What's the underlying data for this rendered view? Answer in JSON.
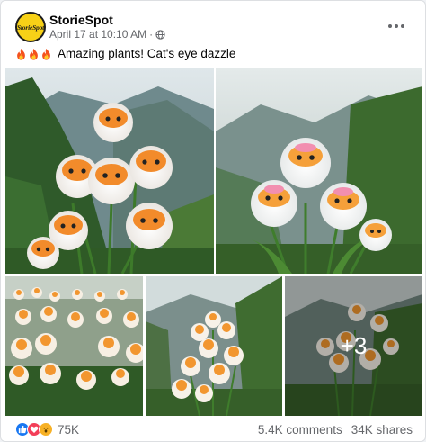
{
  "post": {
    "author": "StorieSpot",
    "avatar_text": "StorieSpot",
    "date": "April 17 at 10:10 AM",
    "separator": "·",
    "privacy_icon": "globe-icon",
    "caption_emojis": [
      "fire-icon",
      "fire-icon",
      "fire-icon"
    ],
    "caption": "Amazing plants! Cat's eye dazzle",
    "more_photos_label": "+3",
    "photos": [
      "cat-eye-flower-photo-1",
      "cat-eye-flower-photo-2",
      "cat-eye-flower-photo-3",
      "cat-eye-flower-photo-4",
      "cat-eye-flower-photo-5"
    ]
  },
  "footer": {
    "reaction_icons": [
      "like-icon",
      "love-icon",
      "wow-icon"
    ],
    "reaction_count": "75K",
    "comments": "5.4K comments",
    "shares": "34K shares"
  },
  "colors": {
    "like": "#1877f2",
    "love": "#f33e58",
    "wow": "#f7b125",
    "avatar_bg": "#f7d117",
    "secondary_text": "#65676b"
  }
}
